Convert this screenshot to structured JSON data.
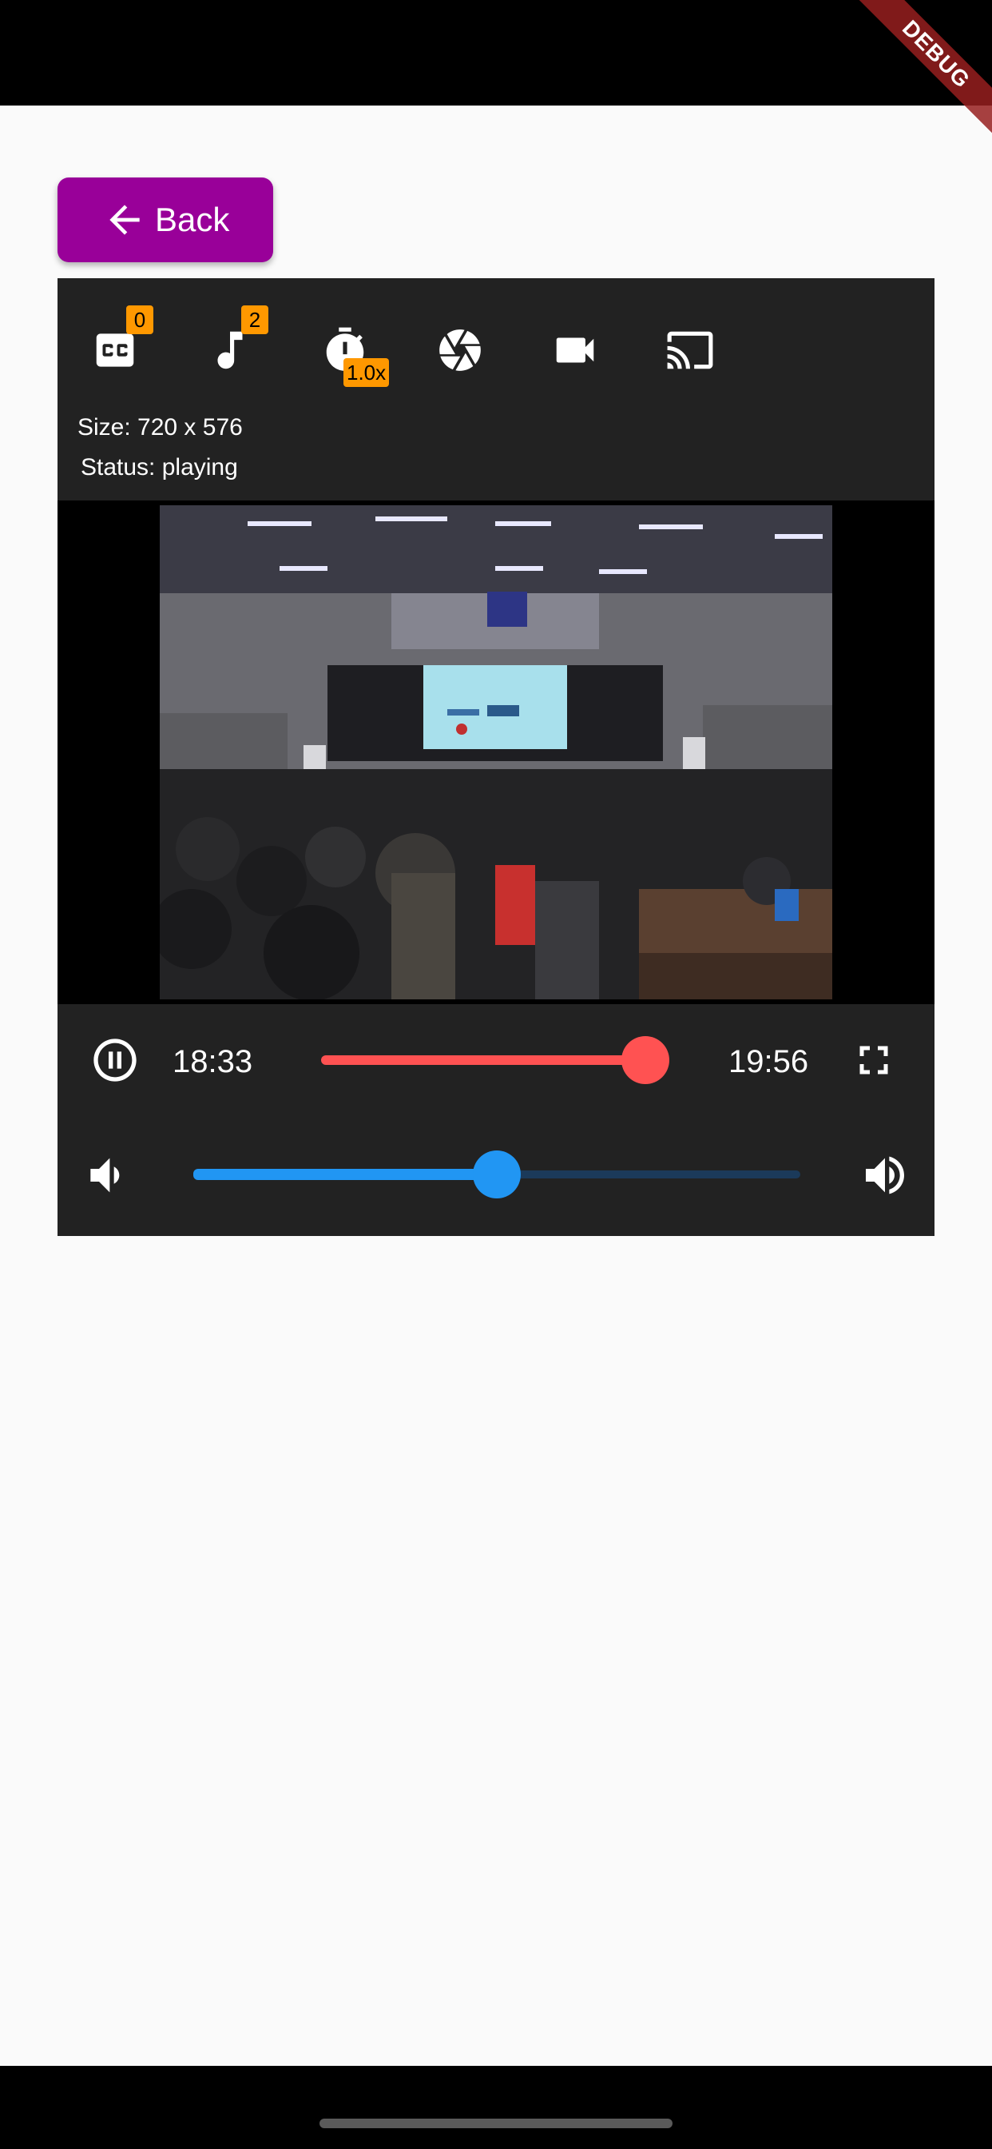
{
  "debug_banner": "DEBUG",
  "back_button": {
    "label": "Back"
  },
  "toolbar": {
    "subtitles_count": "0",
    "audio_tracks_count": "2",
    "speed": "1.0x"
  },
  "info": {
    "size": "Size: 720 x 576",
    "status": "Status: playing"
  },
  "controls": {
    "position": "18:33",
    "duration": "19:56",
    "progress_fraction": 0.929,
    "volume_fraction": 0.5
  },
  "colors": {
    "back_button": "#990099",
    "badge": "#ff9800",
    "progress": "#ff5252",
    "volume": "#2196f3"
  },
  "icons": [
    "closed-caption-icon",
    "music-note-icon",
    "timer-icon",
    "camera-shutter-icon",
    "videocam-icon",
    "cast-icon",
    "pause-icon",
    "fullscreen-icon",
    "volume-down-icon",
    "volume-up-icon"
  ]
}
